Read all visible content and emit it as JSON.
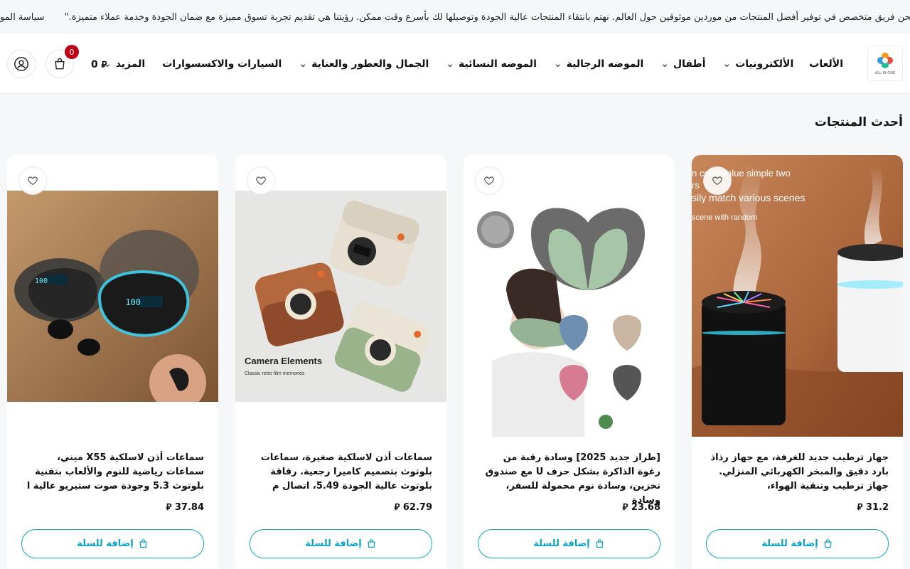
{
  "ticker": {
    "about_text": "من نحن\"نحن فريق متخصص في توفير أفضل المنتجات من موردين موثوقين حول العالم. نهتم بانتقاء المنتجات عالية الجودة وتوصيلها لك بأسرع وقت ممكن. رؤيتنا هي تقديم تجربة تسوق مميزة مع ضمان الجودة وخدمة عملاء متميزة.\"",
    "policy_text": "سياسة المو"
  },
  "header": {
    "logo_text": "ALL IN ONE",
    "nav": [
      {
        "label": "الألعاب",
        "has_dropdown": false
      },
      {
        "label": "الألكترونيات",
        "has_dropdown": true
      },
      {
        "label": "أطفال",
        "has_dropdown": true
      },
      {
        "label": "الموضه الرجالية",
        "has_dropdown": true
      },
      {
        "label": "الموضه النسائية",
        "has_dropdown": true
      },
      {
        "label": "الجمال والعطور والعناية",
        "has_dropdown": true
      },
      {
        "label": "السيارات والاكسسوارات",
        "has_dropdown": false
      },
      {
        "label": "المزيد",
        "has_dropdown": true
      }
    ],
    "cart_count": "0",
    "cart_total": "0"
  },
  "section": {
    "title": "أحدث المنتجات"
  },
  "products": [
    {
      "title": "جهاز ترطيب جديد للغرفة، مع جهاز رذاذ بارد دقيق والمبخر الكهربائي المنزلي. جهاز ترطيب وتنقية الهواء،",
      "price": "31.2",
      "add_label": "إضافة للسلة",
      "image_overlay_lines": [
        "n color value simple two",
        "rs",
        "sily match various scenes",
        "scene with random"
      ]
    },
    {
      "title": "[طراز جديد 2025] وسادة رقبة من رغوة الذاكرة بشكل حرف U مع صندوق تخزين، وسادة نوم محمولة للسفر، وسادة",
      "price": "23.68",
      "add_label": "إضافة للسلة"
    },
    {
      "title": "سماعات أذن لاسلكية صغيرة، سماعات بلوتوث بتصميم كاميرا رجعية. رقاقة بلوتوث عالية الجودة 5.49، اتصال م",
      "price": "62.79",
      "add_label": "إضافة للسلة",
      "image_caption": "Camera Elements",
      "image_subcaption": "Classic retro film memories"
    },
    {
      "title": "سماعات أذن لاسلكية X55 ميني، سماعات رياضية للنوم والألعاب بتقنية بلوتوث 5.3 وجودة صوت ستيريو عالية ا",
      "price": "37.84",
      "add_label": "إضافة للسلة"
    }
  ],
  "currency_symbol": "⃁",
  "colors": {
    "accent": "#0aa2c7",
    "badge": "#c00016"
  }
}
